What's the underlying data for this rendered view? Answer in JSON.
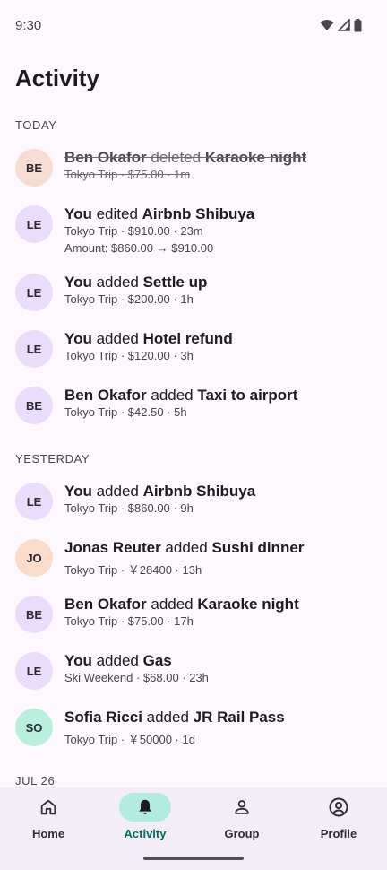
{
  "status_bar": {
    "time": "9:30"
  },
  "header": {
    "title": "Activity"
  },
  "sections": [
    {
      "label": "TODAY"
    },
    {
      "label": "YESTERDAY"
    },
    {
      "label": "JUL 26"
    }
  ],
  "items": [
    {
      "initials": "BE",
      "actor": "Ben Okafor",
      "verb": " deleted ",
      "target": "Karaoke night",
      "sub": "Tokyo Trip · $75.00 · 1m"
    },
    {
      "initials": "LE",
      "actor": "You",
      "verb": " edited ",
      "target": "Airbnb Shibuya",
      "sub": "Tokyo Trip · $910.00 · 23m",
      "sub2": "Amount: $860.00 → $910.00"
    },
    {
      "initials": "LE",
      "actor": "You",
      "verb": " added ",
      "target": "Settle up",
      "sub": "Tokyo Trip · $200.00 · 1h"
    },
    {
      "initials": "LE",
      "actor": "You",
      "verb": " added ",
      "target": "Hotel refund",
      "sub": "Tokyo Trip · $120.00 · 3h"
    },
    {
      "initials": "BE",
      "actor": "Ben Okafor",
      "verb": " added ",
      "target": "Taxi to airport",
      "sub": "Tokyo Trip · $42.50 · 5h"
    },
    {
      "initials": "LE",
      "actor": "You",
      "verb": " added ",
      "target": "Airbnb Shibuya",
      "sub": "Tokyo Trip · $860.00 · 9h"
    },
    {
      "initials": "JO",
      "actor": "Jonas Reuter",
      "verb": " added ",
      "target": "Sushi dinner",
      "sub": "Tokyo Trip · ￥28400 · 13h"
    },
    {
      "initials": "BE",
      "actor": "Ben Okafor",
      "verb": " added ",
      "target": "Karaoke night",
      "sub": "Tokyo Trip · $75.00 · 17h"
    },
    {
      "initials": "LE",
      "actor": "You",
      "verb": " added ",
      "target": "Gas",
      "sub": "Ski Weekend · $68.00 · 23h"
    },
    {
      "initials": "SO",
      "actor": "Sofia Ricci",
      "verb": " added ",
      "target": "JR Rail Pass",
      "sub": "Tokyo Trip · ￥50000 · 1d"
    }
  ],
  "nav": [
    {
      "label": "Home",
      "icon": "home-icon"
    },
    {
      "label": "Activity",
      "icon": "bell-icon",
      "active": true
    },
    {
      "label": "Group",
      "icon": "person-icon"
    },
    {
      "label": "Profile",
      "icon": "account-circle-icon"
    }
  ],
  "colors": {
    "accent": "#b2ebdf",
    "avatar_purple": "#eaddfc",
    "avatar_peach": "#f7dcd3",
    "avatar_orange": "#fbdccb",
    "avatar_mint": "#b8f0dd"
  }
}
